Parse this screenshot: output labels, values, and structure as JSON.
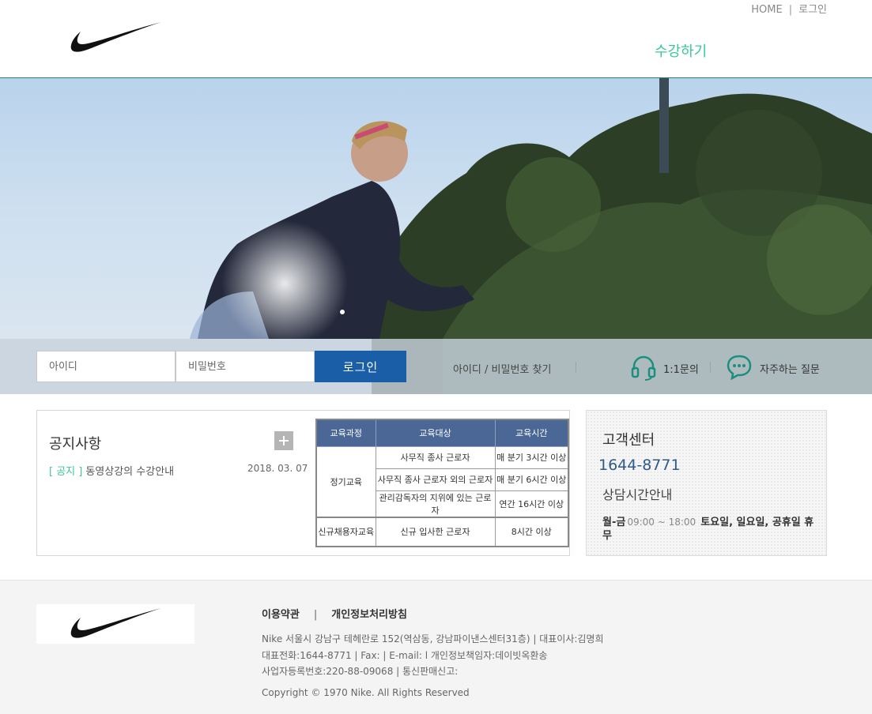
{
  "header": {
    "util_home": "HOME",
    "util_sep": "|",
    "util_login": "로그인",
    "nav_enroll": "수강하기"
  },
  "login": {
    "id_placeholder": "아이디",
    "pw_placeholder": "비밀번호",
    "button": "로그인",
    "find_link": "아이디 / 비밀번호 찾기",
    "inquiry": "1:1문의",
    "faq": "자주하는 질문"
  },
  "notice": {
    "title": "공지사항",
    "items": [
      {
        "tag": "[ 공지 ]",
        "title": "동영상강의 수강안내",
        "date": "2018. 03. 07"
      }
    ]
  },
  "education_table": {
    "headers": [
      "교육과정",
      "교육대상",
      "교육시간"
    ],
    "group1": "정기교육",
    "rows": [
      {
        "target": "사무직 종사 근로자",
        "time": "매 분기 3시간 이상"
      },
      {
        "target": "사무직 종사 근로자 외의 근로자",
        "time": "매 분기 6시간 이상"
      },
      {
        "target": "관리감독자의 지위에 있는 근로자",
        "time": "연간 16시간 이상"
      }
    ],
    "group2": "신규채용자교육",
    "new_target": "신규 입사한 근로자",
    "new_time": "8시간 이상"
  },
  "customer_center": {
    "title": "고객센터",
    "phone": "1644-8771",
    "hours_title": "상담시간안내",
    "days": "월-금",
    "time": "09:00 ~ 18:00",
    "closed": "토요일, 일요일, 공휴일 휴무"
  },
  "footer": {
    "terms": "이용약관",
    "sep": "|",
    "privacy": "개인정보처리방침",
    "line1": "Nike 서울시 강남구 테헤란로 152(역삼동, 강남파이낸스센터31층) | 대표이사:김명희",
    "line2": "대표전화:1644-8771 | Fax: | E-mail: l 개인정보책임자:데이빗옥환송",
    "line3": "사업자등록번호:220-88-09068 | 통신판매신고:",
    "copyright": "Copyright © 1970 Nike. All Rights Reserved"
  },
  "colors": {
    "accent_green": "#3cc79a",
    "login_button": "#1a5ea8",
    "table_header": "#4a6795",
    "phone": "#2e5b8a"
  },
  "icons": [
    "nike-swoosh-logo",
    "headset-icon",
    "chat-bubble-icon",
    "plus-icon"
  ]
}
